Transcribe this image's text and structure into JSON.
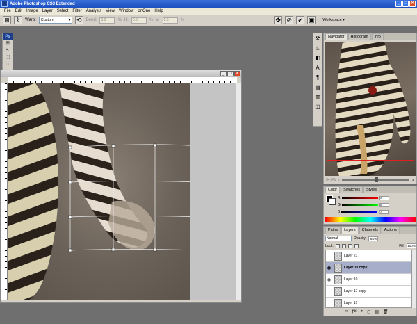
{
  "window": {
    "title": "Adobe Photoshop CS3 Extended",
    "minimize_symbol": "_",
    "maximize_symbol": "□",
    "close_symbol": "✕"
  },
  "menu": [
    "File",
    "Edit",
    "Image",
    "Layer",
    "Select",
    "Filter",
    "Analysis",
    "View",
    "Window",
    "onOne",
    "Help"
  ],
  "options": {
    "warp_label": "Warp:",
    "warp_value": "Custom",
    "bend_label": "Bend:",
    "bend_value": "0.0",
    "bend_pct": "%",
    "h_label": "H:",
    "h_value": "0.0",
    "h_pct": "%",
    "v_label": "V:",
    "v_value": "0.0",
    "v_pct": "%",
    "cancel_symbol": "⊘",
    "commit_symbol": "✔",
    "workspace_label": "Workspace ▾"
  },
  "toolbox": {
    "logo": "Ps",
    "tools": [
      "⊞",
      "↖",
      "⬚",
      "◌",
      "✂",
      "⌫",
      "✚",
      "✎",
      "⟲",
      "▦",
      "◐",
      "⬤",
      "✋",
      "⌕",
      "T",
      "➚",
      "◻",
      "☌",
      "✋",
      "⌕"
    ]
  },
  "doc": {
    "minimize_symbol": "_",
    "maximize_symbol": "□",
    "close_symbol": "✕"
  },
  "mini_tools": [
    "⚒",
    "♨",
    "◧",
    "A",
    "¶",
    "▤",
    "▥",
    "◫"
  ],
  "navigator": {
    "tabs": [
      "Navigator",
      "Histogram",
      "Info"
    ],
    "zoom": "34.6%"
  },
  "color_panel": {
    "tabs": [
      "Color",
      "Swatches",
      "Styles"
    ],
    "r_label": "R",
    "g_label": "G",
    "b_label": "B",
    "r_value": "0",
    "g_value": "0",
    "b_value": "0"
  },
  "layers": {
    "tabs": [
      "Paths",
      "Layers",
      "Channels",
      "Actions"
    ],
    "blend_mode": "Normal",
    "opacity_label": "Opacity:",
    "opacity_value": "64%",
    "lock_label": "Lock:",
    "fill_label": "Fill:",
    "fill_value": "100%",
    "items": [
      {
        "name": "Layer 21",
        "visible": false,
        "selected": false
      },
      {
        "name": "Layer 10 copy",
        "visible": true,
        "selected": true
      },
      {
        "name": "Layer 10",
        "visible": true,
        "selected": false
      },
      {
        "name": "Layer 17 copy",
        "visible": false,
        "selected": false
      },
      {
        "name": "Layer 17",
        "visible": false,
        "selected": false
      }
    ],
    "footer_icons": [
      "∞",
      "ƒx",
      "◑",
      "◻",
      "▤",
      "🗑"
    ]
  },
  "colors": {
    "title_bar": "#2458c8",
    "selection": "#a6aec9",
    "nav_rect": "#e02020"
  }
}
